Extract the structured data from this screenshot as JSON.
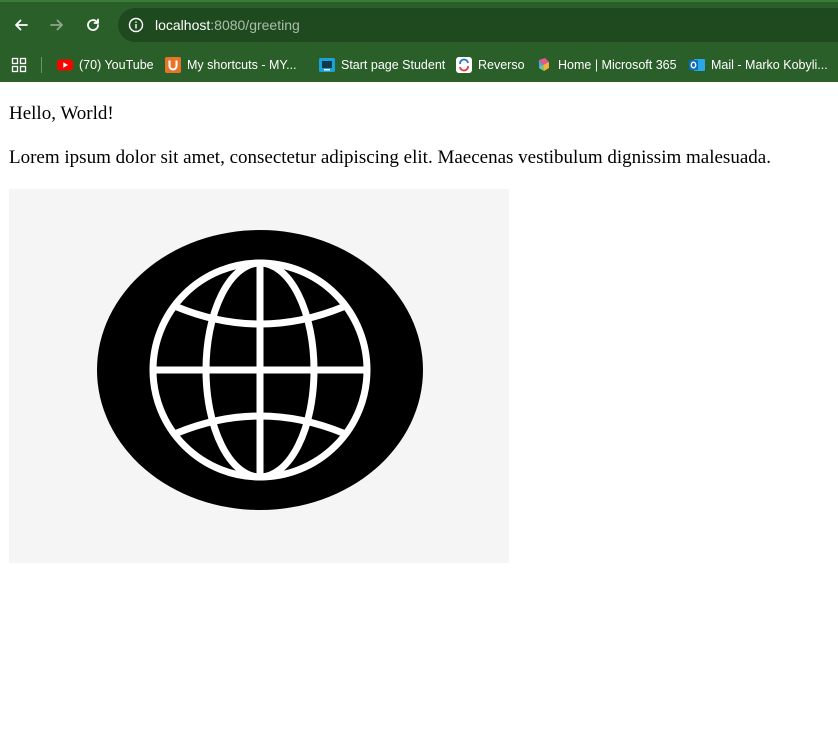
{
  "browser": {
    "url_host": "localhost",
    "url_path": ":8080/greeting",
    "nav": {
      "back_icon": "arrow-left-icon",
      "forward_icon": "arrow-right-icon",
      "reload_icon": "reload-icon",
      "site_info_icon": "info-icon"
    }
  },
  "bookmarks": [
    {
      "label": "(70) YouTube",
      "icon": "youtube-icon",
      "color": "#ff0000"
    },
    {
      "label": "My shortcuts - MY...",
      "icon": "u-icon",
      "color": "#e8742a"
    },
    {
      "label": "Start page Student",
      "icon": "start-page-icon",
      "color": "#1aa3d9"
    },
    {
      "label": "Reverso",
      "icon": "reverso-icon",
      "color": "#1f72c6"
    },
    {
      "label": "Home | Microsoft 365",
      "icon": "microsoft-365-icon",
      "color": "#7b5cd6"
    },
    {
      "label": "Mail - Marko Kobyli...",
      "icon": "outlook-icon",
      "color": "#0f6cbd"
    }
  ],
  "page": {
    "greeting": "Hello, World!",
    "paragraph": "Lorem ipsum dolor sit amet, consectetur adipiscing elit. Maecenas vestibulum dignissim malesuada.",
    "image_icon": "globe-icon"
  },
  "colors": {
    "chrome_bg": "#2b5f2a",
    "omnibox_bg": "#1f4a1f"
  }
}
